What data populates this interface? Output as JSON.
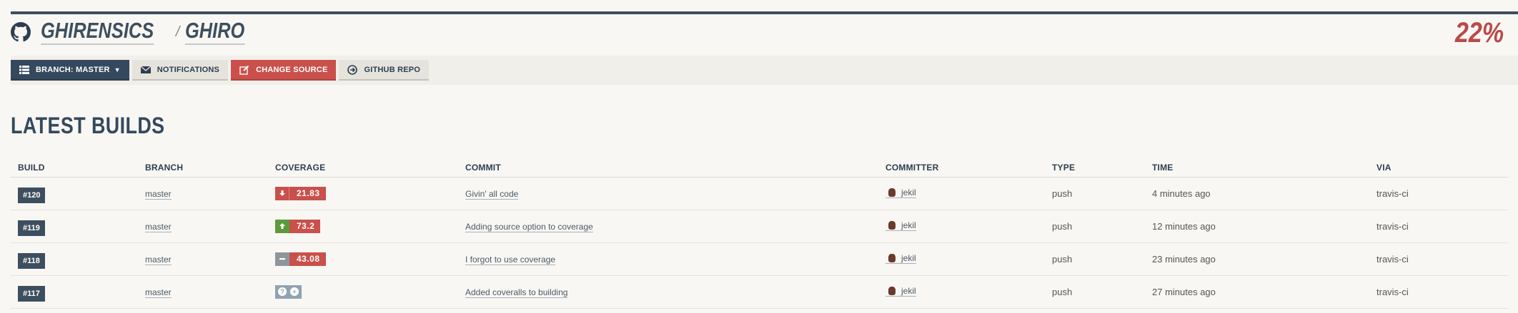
{
  "header": {
    "owner": "GHIRENSICS",
    "separator": "/",
    "repo": "GHIRO",
    "coverage_percent": "22%"
  },
  "toolbar": {
    "branch_label": "BRANCH: MASTER",
    "notifications_label": "NOTIFICATIONS",
    "change_source_label": "CHANGE SOURCE",
    "github_repo_label": "GITHUB REPO"
  },
  "section_title": "LATEST BUILDS",
  "table": {
    "headers": [
      "BUILD",
      "BRANCH",
      "COVERAGE",
      "COMMIT",
      "COMMITTER",
      "TYPE",
      "TIME",
      "VIA"
    ],
    "rows": [
      {
        "build": "#120",
        "branch": "master",
        "coverage": "21.83",
        "trend": "down",
        "commit": "Givin' all code",
        "committer": "jekil",
        "type": "push",
        "time": "4 minutes ago",
        "via": "travis-ci"
      },
      {
        "build": "#119",
        "branch": "master",
        "coverage": "73.2",
        "trend": "up",
        "commit": "Adding source option to coverage",
        "committer": "jekil",
        "type": "push",
        "time": "12 minutes ago",
        "via": "travis-ci"
      },
      {
        "build": "#118",
        "branch": "master",
        "coverage": "43.08",
        "trend": "flat",
        "commit": "I forgot to use coverage",
        "committer": "jekil",
        "type": "push",
        "time": "23 minutes ago",
        "via": "travis-ci"
      },
      {
        "build": "#117",
        "branch": "master",
        "coverage": "",
        "trend": "unknown",
        "commit": "Added coveralls to building",
        "committer": "jekil",
        "type": "push",
        "time": "27 minutes ago",
        "via": "travis-ci"
      }
    ]
  },
  "colors": {
    "dark": "#34495e",
    "red": "#c9504b",
    "green": "#5a9a3c",
    "gray": "#8e969b",
    "background": "#f9f7f3"
  }
}
